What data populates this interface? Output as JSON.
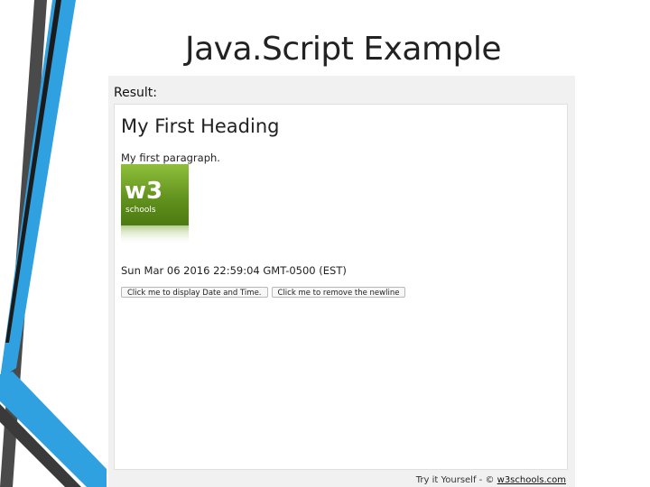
{
  "slide": {
    "title": "Java.Script Example"
  },
  "frame": {
    "result_label": "Result:",
    "heading": "My First Heading",
    "paragraph": "My first paragraph.",
    "logo": {
      "icon": "w3schools-logo",
      "text": "schools",
      "mark": "w3"
    },
    "datetime": "Sun Mar 06 2016 22:59:04 GMT-0500 (EST)",
    "buttons": [
      {
        "label": "Click me to display Date and Time."
      },
      {
        "label": "Click me to remove the newline"
      }
    ],
    "footer": {
      "prefix": "Try it Yourself - ©",
      "link": "w3schools.com"
    }
  },
  "colors": {
    "accent_blue": "#2fa0e0",
    "dark_stripe": "#4a4a4a",
    "logo_green": "#6a9a22"
  }
}
